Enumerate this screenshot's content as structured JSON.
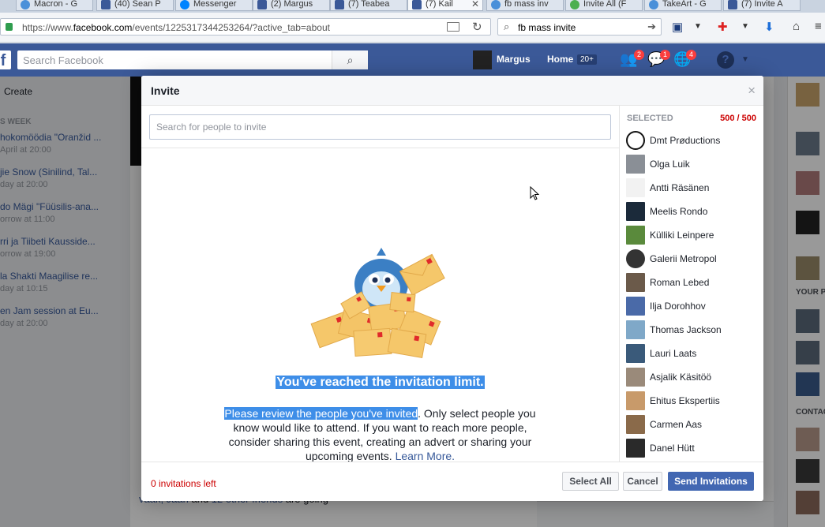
{
  "browser": {
    "tabs": [
      {
        "title": "Macron - G",
        "color": "#4a90d9"
      },
      {
        "title": "(40) Sean P",
        "color": "#3b5998"
      },
      {
        "title": "Messenger",
        "color": "#0084ff"
      },
      {
        "title": "(2) Margus",
        "color": "#3b5998"
      },
      {
        "title": "(7) Teabea",
        "color": "#3b5998"
      },
      {
        "title": "(7) Kail",
        "color": "#3b5998"
      },
      {
        "title": "fb mass inv",
        "color": "#4a90d9"
      },
      {
        "title": "Invite All (F",
        "color": "#4caf50"
      },
      {
        "title": "TakeArt - G",
        "color": "#4a90d9"
      },
      {
        "title": "(7) Invite A",
        "color": "#3b5998"
      }
    ],
    "url_prefix": "https://www.",
    "url_domain": "facebook.com",
    "url_path": "/events/1225317344253264/?active_tab=about",
    "search_value": "fb mass invite"
  },
  "fb": {
    "search_placeholder": "Search Facebook",
    "user_name": "Margus",
    "home_label": "Home",
    "home_count": "20+",
    "friend_badge": "2",
    "msg_badge": "1",
    "notif_badge": "4",
    "help_label": "?"
  },
  "background": {
    "create_label": "Create",
    "week_label": "S WEEK",
    "events": [
      {
        "title": "hokomöödia \"Oranžid ...",
        "date": "April at 20:00"
      },
      {
        "title": "jie Snow (Sinilind, Tal...",
        "date": "day at 20:00"
      },
      {
        "title": "do Mägi \"Füüsilis-ana...",
        "date": "orrow at 11:00"
      },
      {
        "title": "rri ja Tiibeti Kausside...",
        "date": "orrow at 19:00"
      },
      {
        "title": "la Shakti Maagilise re...",
        "date": "day at 10:15"
      },
      {
        "title": "en Jam session at Eu...",
        "date": "day at 20:00"
      }
    ],
    "going_text_prefix": "vaak, Jaan",
    "going_text_and": " and ",
    "going_text_others": "12 other friends",
    "going_text_suffix": " are going",
    "right_your": "YOUR P",
    "right_contacts": "CONTAC"
  },
  "dialog": {
    "title": "Invite",
    "close_label": "×",
    "search_placeholder": "Search for people to invite",
    "limit_title": "You've reached the invitation limit.",
    "desc_highlight": "Please review the people you've invited",
    "desc_rest": ". Only select people you know would like to attend. If you want to reach more people, consider sharing this event, creating an advert or sharing your upcoming events. ",
    "learn_more": "Learn More.",
    "selected_label": "SELECTED",
    "selected_count": "500 / 500",
    "selected": [
      {
        "name": "Dmt Prøductions",
        "color": "#ffffff"
      },
      {
        "name": "Olga Luik",
        "color": "#8a8f96"
      },
      {
        "name": "Antti Räsänen",
        "color": "#f2f2f2"
      },
      {
        "name": "Meelis Rondo",
        "color": "#1b2a3a"
      },
      {
        "name": "Külliki Leinpere",
        "color": "#5a8a3c"
      },
      {
        "name": "Galerii Metropol",
        "color": "#333333"
      },
      {
        "name": "Roman Lebed",
        "color": "#6b5a4a"
      },
      {
        "name": "Ilja Dorohhov",
        "color": "#4a6aa8"
      },
      {
        "name": "Thomas Jackson",
        "color": "#7fa8c8"
      },
      {
        "name": "Lauri Laats",
        "color": "#3a5a7a"
      },
      {
        "name": "Asjalik Käsitöö",
        "color": "#9a8a7a"
      },
      {
        "name": "Ehitus Ekspertiis",
        "color": "#c89a6a"
      },
      {
        "name": "Carmen Aas",
        "color": "#8a6a4a"
      },
      {
        "name": "Danel Hütt",
        "color": "#2a2a2a"
      }
    ],
    "invitations_left": "0 invitations left",
    "select_all": "Select All",
    "cancel": "Cancel",
    "send": "Send Invitations"
  },
  "colors": {
    "fb_blue": "#3b5998",
    "button_blue": "#4267b2",
    "limit_red": "#cc0000",
    "selection_highlight": "#3e8ee8"
  }
}
